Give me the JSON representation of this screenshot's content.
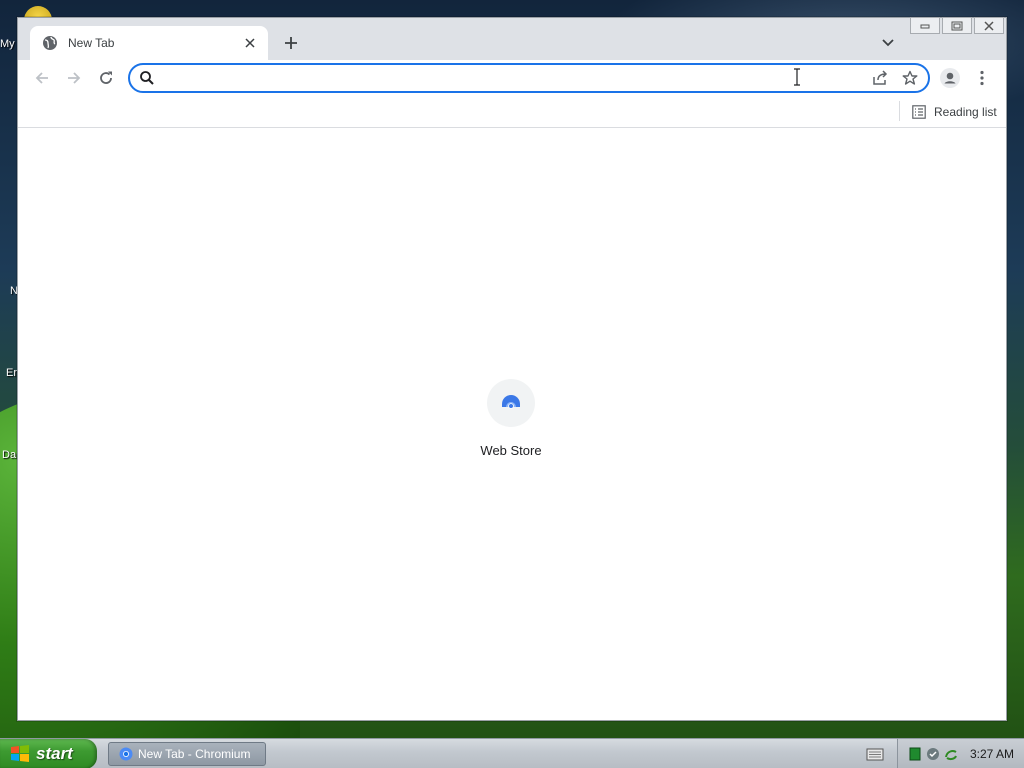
{
  "desktop": {
    "icon_labels": [
      "My",
      "N",
      "Er",
      "Da"
    ]
  },
  "browser": {
    "tab": {
      "title": "New Tab"
    },
    "omnibox": {
      "value": "",
      "placeholder": ""
    },
    "bookmarks_bar": {
      "reading_list_label": "Reading list"
    },
    "shortcuts": [
      {
        "label": "Web Store"
      }
    ],
    "colors": {
      "accent": "#1a73e8",
      "frame": "#dee1e6",
      "tile": "#f1f3f4"
    }
  },
  "taskbar": {
    "start_label": "start",
    "task_item_label": "New Tab - Chromium",
    "clock": "3:27 AM"
  },
  "icons": {
    "tab_favicon": "globe-icon",
    "tab_close": "close-icon",
    "new_tab": "plus-icon",
    "tab_search": "chevron-down-icon",
    "back": "arrow-left-icon",
    "forward": "arrow-right-icon",
    "reload": "reload-icon",
    "omnibox_search": "search-icon",
    "share": "share-icon",
    "bookmark": "star-icon",
    "profile": "profile-icon",
    "menu": "kebab-menu-icon",
    "reading_list": "reading-list-icon",
    "shortcut": "web-store-icon"
  }
}
